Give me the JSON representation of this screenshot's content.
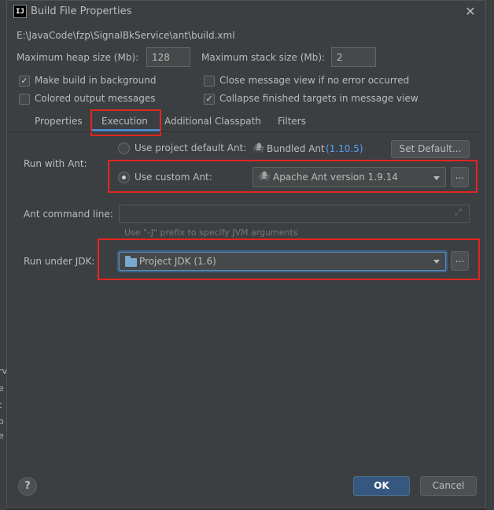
{
  "window": {
    "title": "Build File Properties",
    "app_icon": "IJ"
  },
  "file_path": "E:\\JavaCode\\fzp\\SignalBkService\\ant\\build.xml",
  "heap": {
    "label": "Maximum heap size (Mb):",
    "value": "128"
  },
  "stack": {
    "label": "Maximum stack size (Mb):",
    "value": "2"
  },
  "checkboxes": [
    {
      "label": "Make build in background",
      "checked": true
    },
    {
      "label": "Close message view if no error occurred",
      "checked": false
    },
    {
      "label": "Colored output messages",
      "checked": false
    },
    {
      "label": "Collapse finished targets in message view",
      "checked": true
    }
  ],
  "tabs": [
    {
      "label": "Properties",
      "selected": false
    },
    {
      "label": "Execution",
      "selected": true
    },
    {
      "label": "Additional Classpath",
      "selected": false
    },
    {
      "label": "Filters",
      "selected": false
    }
  ],
  "run_with_ant": {
    "label": "Run with Ant:",
    "default_option": "Use project default Ant:",
    "bundled_label": "Bundled Ant",
    "bundled_version": "(1.10.5)",
    "set_default_button": "Set Default...",
    "custom_option": "Use custom Ant:",
    "custom_value": "Apache Ant version 1.9.14",
    "selected": "custom"
  },
  "ant_command_line": {
    "label": "Ant command line:",
    "value": "",
    "hint": "Use \"-J\" prefix to specify JVM arguments"
  },
  "jdk": {
    "label": "Run under JDK:",
    "value": "Project JDK (1.6)"
  },
  "browse_label": "...",
  "footer": {
    "help": "?",
    "ok": "OK",
    "cancel": "Cancel"
  },
  "background_glyphs": [
    "rv",
    "e",
    "t",
    "o",
    "e"
  ],
  "colors": {
    "accent": "#4a88c7",
    "highlight": "#e3261f",
    "primary_button": "#365880",
    "link": "#589df6"
  }
}
